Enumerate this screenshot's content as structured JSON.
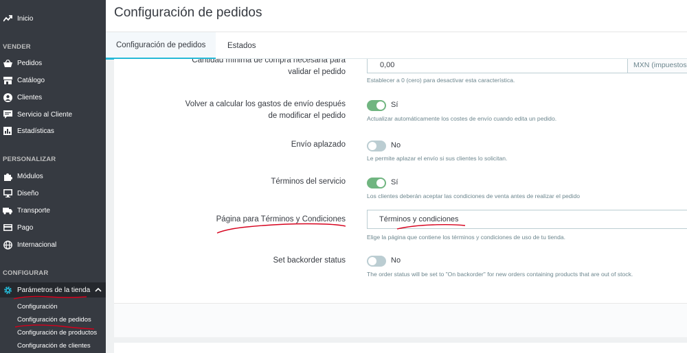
{
  "sidebar": {
    "inicio": "Inicio",
    "section_vender": "VENDER",
    "vender": [
      "Pedidos",
      "Catálogo",
      "Clientes",
      "Servicio al Cliente",
      "Estadísticas"
    ],
    "section_personalizar": "PERSONALIZAR",
    "personalizar": [
      "Módulos",
      "Diseño",
      "Transporte",
      "Pago",
      "Internacional"
    ],
    "section_configurar": "CONFIGURAR",
    "parametros": "Parámetros de la tienda",
    "sub": [
      "Configuración",
      "Configuración de pedidos",
      "Configuración de productos",
      "Configuración de clientes"
    ]
  },
  "header": {
    "title": "Configuración de pedidos"
  },
  "tabs": [
    "Configuración de pedidos",
    "Estados"
  ],
  "form": {
    "min_purchase": {
      "label_line1": "Cantidad mínima de compra necesaria para",
      "label_line2": "validar el pedido",
      "value": "0,00",
      "addon": "MXN (impuestos",
      "help": "Establecer a 0 (cero) para desactivar esta característica."
    },
    "recalc_shipping": {
      "label_line1": "Volver a calcular los gastos de envío después",
      "label_line2": "de modificar el pedido",
      "state": "Sí",
      "help": "Actualizar automáticamente los costes de envío cuando edita un pedido."
    },
    "delayed_shipping": {
      "label": "Envío aplazado",
      "state": "No",
      "help": "Le permite aplazar el envío si sus clientes lo solicitan."
    },
    "terms": {
      "label": "Términos del servicio",
      "state": "Sí",
      "help": "Los clientes deberán aceptar las condiciones de venta antes de realizar el pedido"
    },
    "terms_page": {
      "label": "Página para Términos y Condiciones",
      "value": "Términos y condiciones",
      "help": "Elige la página que contiene los términos y condiciones de uso de tu tienda."
    },
    "backorder": {
      "label": "Set backorder status",
      "state": "No",
      "help": "The order status will be set to \"On backorder\" for new orders containing products that are out of stock."
    }
  },
  "colors": {
    "sidebar": "#363a41",
    "accent": "#25b9d7",
    "switch_on": "#70b580",
    "annotation": "#d6001c"
  }
}
